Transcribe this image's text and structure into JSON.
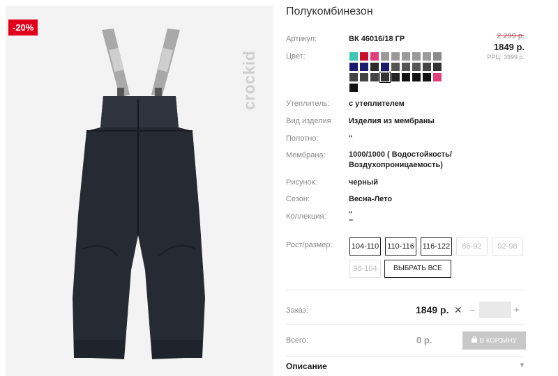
{
  "product": {
    "title": "Полукомбинезон",
    "discount_badge": "-20%",
    "brand_mark": "crockid",
    "image_icon": "snow-pants-photo"
  },
  "details": {
    "article_label": "Артикул:",
    "article_value": "ВК 46016/18 ГР",
    "color_label": "Цвет:",
    "insulation_label": "Утеплитель:",
    "insulation_value": "с утеплителем",
    "type_label": "Вид изделия",
    "type_value": "Изделия из мембраны",
    "fabric_label": "Полотно:",
    "fabric_value": "\"",
    "membrane_label": "Мембрана:",
    "membrane_value_1": "1000/1000 ( Водостойкость/",
    "membrane_value_2": "Воздухопроницаемость)",
    "pattern_label": "Рисунок:",
    "pattern_value": "черный",
    "season_label": "Сезон:",
    "season_value": "Весна-Лето",
    "collection_label": "Коллекция:",
    "collection_value_1": "\"",
    "collection_value_2": "–",
    "size_label": "Рост/размер:"
  },
  "price": {
    "old": "2 299 р.",
    "new": "1849 р.",
    "rrp": "РРЦ: 3999 р."
  },
  "swatch_colors": [
    "#3cc7b4",
    "#c8102e",
    "#e0407a",
    "#9a9a9a",
    "#9a9a9a",
    "#9a9a9a",
    "#9a9a9a",
    "#9a9a9a",
    "#8a8a8a",
    "#1a1a6e",
    "#1a1a6e",
    "#2a2a2a",
    "#1a1a6e",
    "#555555",
    "#555555",
    "#555555",
    "#444444",
    "#333333",
    "#444444",
    "#444444",
    "#444444",
    "#333333",
    "#222222",
    "#111111",
    "#111111",
    "#111111",
    "#e0407a",
    "#111111"
  ],
  "selected_swatch_index": 21,
  "sizes": [
    {
      "label": "104-110",
      "available": true
    },
    {
      "label": "110-116",
      "available": true
    },
    {
      "label": "116-122",
      "available": true
    },
    {
      "label": "86-92",
      "available": false
    },
    {
      "label": "92-98",
      "available": false
    },
    {
      "label": "98-104",
      "available": false
    }
  ],
  "select_all_label": "ВЫБРАТЬ ВСЕ",
  "order": {
    "label": "Заказ:",
    "price": "1849 р.",
    "times": "✕",
    "minus": "–",
    "plus": "+",
    "qty_value": ""
  },
  "total": {
    "label": "Всего:",
    "value": "0 р.",
    "cart_label": "В КОРЗИНУ",
    "cart_icon": "shopping-bag-icon"
  },
  "description": {
    "label": "Описание",
    "toggle_icon": "chevron-down-icon"
  }
}
